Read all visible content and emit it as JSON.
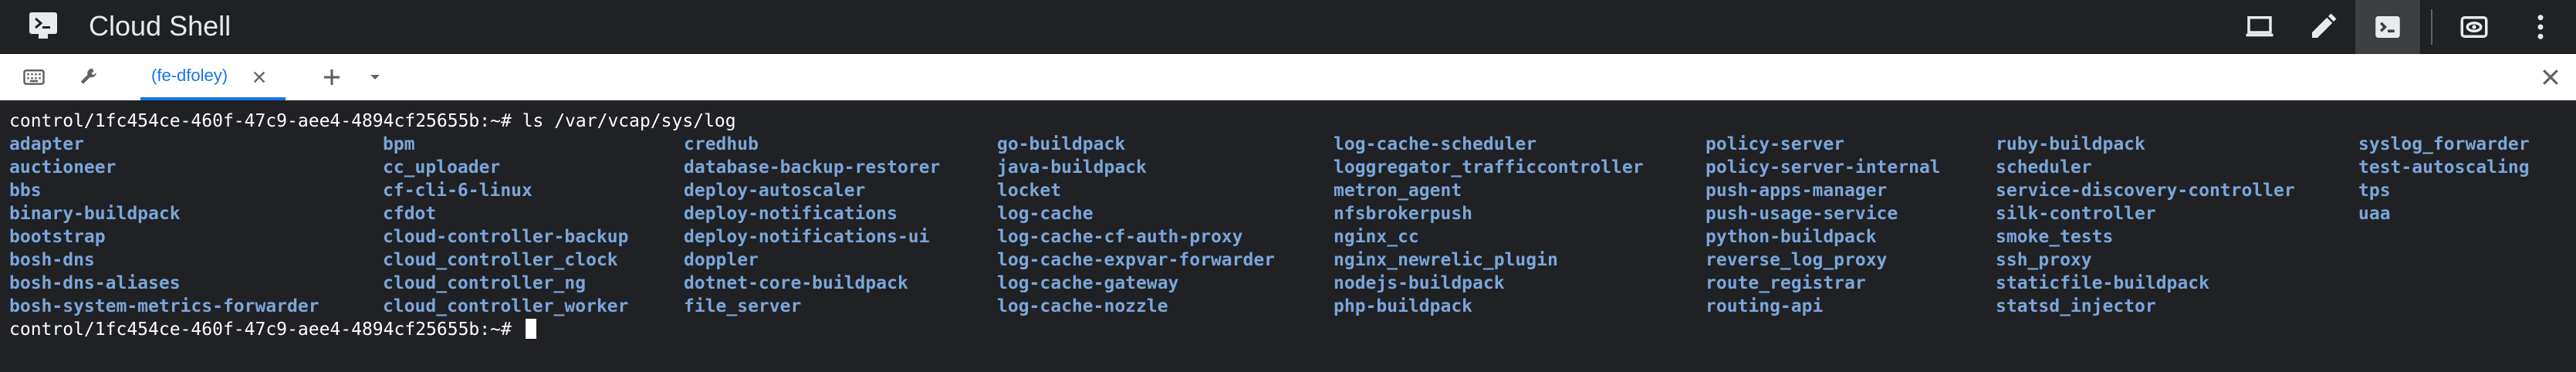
{
  "app": {
    "title": "Cloud Shell",
    "logo_icon": "cloud-shell-logo-icon"
  },
  "toolbar": {
    "buttons": [
      {
        "name": "laptop-icon",
        "label": "Open editor laptop"
      },
      {
        "name": "pencil-icon",
        "label": "Open editor"
      },
      {
        "name": "terminal-icon",
        "label": "Terminal",
        "active": true
      },
      {
        "name": "web-preview-icon",
        "label": "Web preview"
      },
      {
        "name": "more-vert-icon",
        "label": "More"
      }
    ]
  },
  "tabbar": {
    "keyboard_icon": "keyboard-icon",
    "wrench_icon": "wrench-icon",
    "tab_label": "(fe-dfoley)",
    "tab_close_icon": "close-icon",
    "add_icon": "plus-icon",
    "dropdown_icon": "caret-down-icon",
    "close_panel_icon": "close-icon"
  },
  "terminal": {
    "prompt_line": "control/1fc454ce-460f-47c9-aee4-4894cf25655b:~# ls /var/vcap/sys/log",
    "final_prompt": "control/1fc454ce-460f-47c9-aee4-4894cf25655b:~# ",
    "columns": [
      [
        "adapter",
        "auctioneer",
        "bbs",
        "binary-buildpack",
        "bootstrap",
        "bosh-dns",
        "bosh-dns-aliases",
        "bosh-system-metrics-forwarder"
      ],
      [
        "bpm",
        "cc_uploader",
        "cf-cli-6-linux",
        "cfdot",
        "cloud-controller-backup",
        "cloud_controller_clock",
        "cloud_controller_ng",
        "cloud_controller_worker"
      ],
      [
        "credhub",
        "database-backup-restorer",
        "deploy-autoscaler",
        "deploy-notifications",
        "deploy-notifications-ui",
        "doppler",
        "dotnet-core-buildpack",
        "file_server"
      ],
      [
        "go-buildpack",
        "java-buildpack",
        "locket",
        "log-cache",
        "log-cache-cf-auth-proxy",
        "log-cache-expvar-forwarder",
        "log-cache-gateway",
        "log-cache-nozzle"
      ],
      [
        "log-cache-scheduler",
        "loggregator_trafficcontroller",
        "metron_agent",
        "nfsbrokerpush",
        "nginx_cc",
        "nginx_newrelic_plugin",
        "nodejs-buildpack",
        "php-buildpack"
      ],
      [
        "policy-server",
        "policy-server-internal",
        "push-apps-manager",
        "push-usage-service",
        "python-buildpack",
        "reverse_log_proxy",
        "route_registrar",
        "routing-api"
      ],
      [
        "ruby-buildpack",
        "scheduler",
        "service-discovery-controller",
        "silk-controller",
        "smoke_tests",
        "ssh_proxy",
        "staticfile-buildpack",
        "statsd_injector"
      ],
      [
        "syslog_forwarder",
        "test-autoscaling",
        "tps",
        "uaa"
      ]
    ]
  }
}
